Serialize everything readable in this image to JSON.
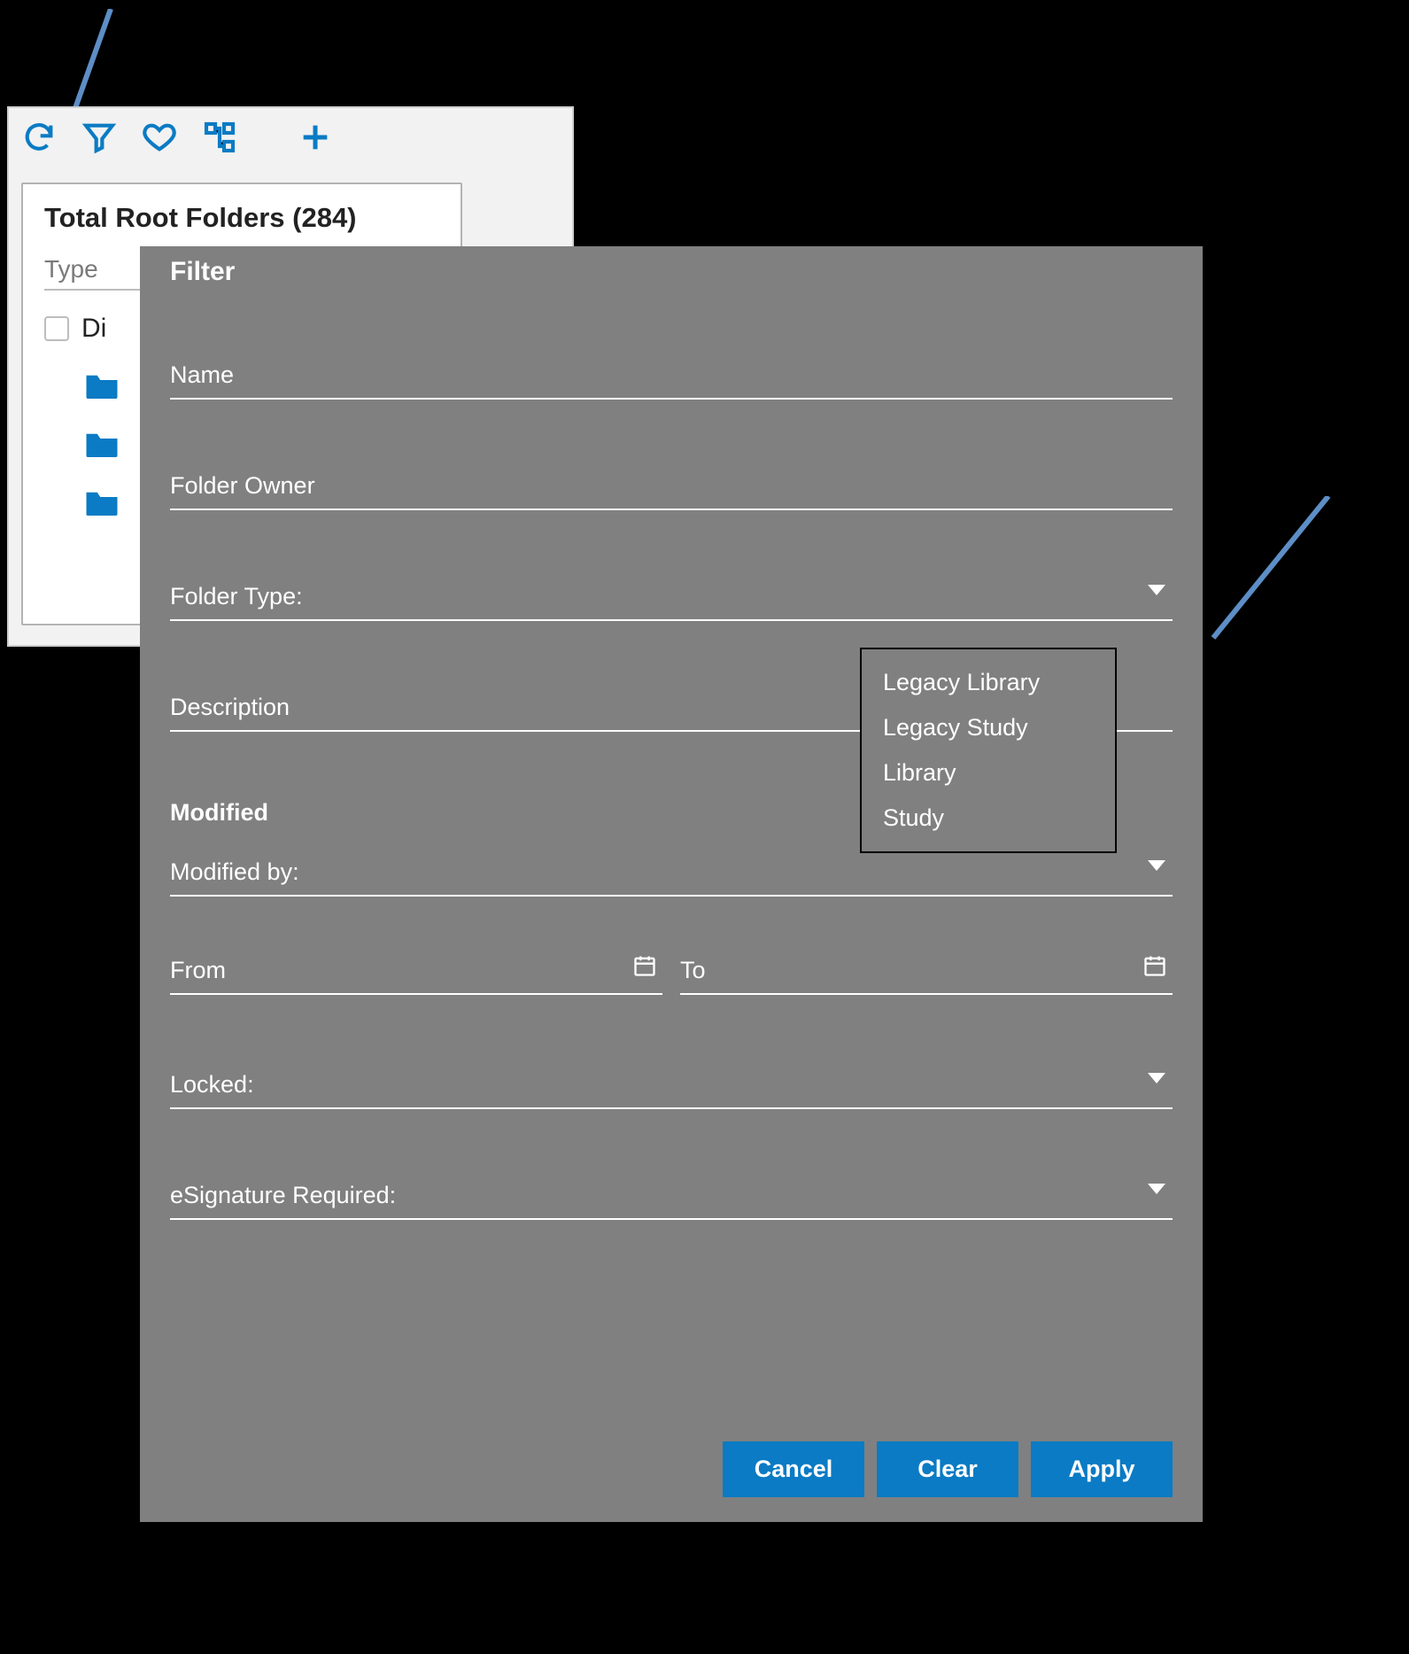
{
  "background": {
    "heading": "Total Root Folders (284)",
    "type_label": "Type",
    "item_text": "Di"
  },
  "callouts": {
    "left_stroke": "#5d8ec6",
    "right_stroke": "#5d8ec6"
  },
  "dialog": {
    "title": "Filter",
    "fields": {
      "name": "Name",
      "folder_owner": "Folder Owner",
      "folder_type": "Folder Type:",
      "description": "Description",
      "modified_heading": "Modified",
      "modified_by": "Modified by:",
      "from": "From",
      "to": "To",
      "locked": "Locked:",
      "esignature": "eSignature Required:"
    },
    "folder_type_options": [
      "Legacy Library",
      "Legacy Study",
      "Library",
      "Study"
    ],
    "buttons": {
      "cancel": "Cancel",
      "clear": "Clear",
      "apply": "Apply"
    }
  }
}
